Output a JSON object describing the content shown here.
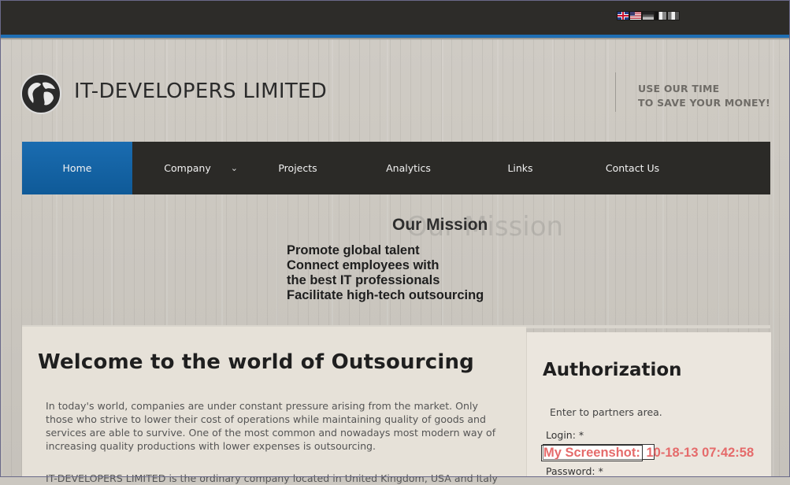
{
  "flags": [
    {
      "name": "flag-uk-icon"
    },
    {
      "name": "flag-us-icon"
    },
    {
      "name": "flag-de-icon"
    },
    {
      "name": "flag-fr-icon"
    },
    {
      "name": "flag-it-icon"
    }
  ],
  "brand": {
    "name": "IT-DEVELOPERS LIMITED",
    "slogan_line1": "USE OUR TIME",
    "slogan_line2": "TO SAVE YOUR MONEY!"
  },
  "nav": {
    "items": [
      {
        "label": "Home",
        "active": true
      },
      {
        "label": "Company",
        "has_dropdown": true
      },
      {
        "label": "Projects"
      },
      {
        "label": "Analytics"
      },
      {
        "label": "Links"
      },
      {
        "label": "Contact Us"
      }
    ]
  },
  "mission": {
    "title": "Our Mission",
    "ghost": "Our Mission",
    "points": [
      "Promote global talent",
      "Connect employees with",
      "the best IT professionals",
      "Facilitate high-tech outsourcing"
    ]
  },
  "main": {
    "heading": "Welcome to the world of Outsourcing",
    "paragraph1": "In today's world, companies are under constant pressure arising from the market. Only those who strive to lower their cost of operations while maintaining quality of goods and services are able to survive. One of the most common and nowadays most modern way of increasing quality productions with lower expenses is outsourcing.",
    "paragraph2": "IT-DEVELOPERS LIMITED is the ordinary company located in United Kingdom, USA and Italy"
  },
  "auth": {
    "heading": "Authorization",
    "intro": "Enter to partners area.",
    "login_label": "Login: *",
    "password_label": "Password: *",
    "login_value": ""
  },
  "watermark": {
    "label": "My Screenshot:",
    "timestamp": "10-18-13 07:42:58"
  },
  "colors": {
    "accent": "#1a6cb0",
    "topbar": "#2d2c29",
    "nav": "#2b2a27",
    "watermark": "#e56b6b"
  }
}
